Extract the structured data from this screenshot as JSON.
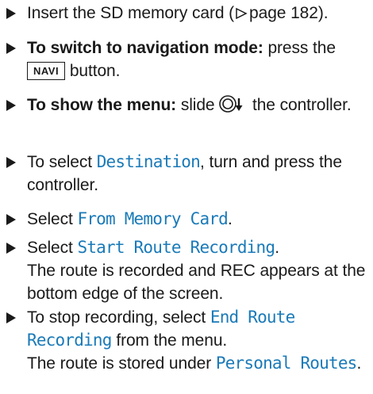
{
  "steps": [
    {
      "text_before": "Insert the SD memory card (",
      "ref": "page 182",
      "text_after": ")."
    },
    {
      "bold": "To switch to navigation mode:",
      "text_before": " press the ",
      "key": "NAVI",
      "text_after": " button."
    },
    {
      "bold": "To show the menu:",
      "text_before": " slide ",
      "text_after": " the control­ler."
    },
    {
      "text_before": "To select ",
      "ui": "Destination",
      "text_after": ", turn and press the controller."
    },
    {
      "text_before": "Select ",
      "ui": "From Memory Card",
      "text_after": "."
    },
    {
      "text_before": "Select ",
      "ui": "Start Route Recording",
      "text_after": ".",
      "result": "The route is recorded and REC appears at the bottom edge of the screen."
    },
    {
      "text_before": "To stop recording, select ",
      "ui": "End Route Recording",
      "text_after": " from the menu.",
      "result_before": "The route is stored under ",
      "result_ui": "Personal Routes",
      "result_after": "."
    }
  ],
  "icons": {
    "bullet": "triangle-right-bullet-icon",
    "page_ref": "page-reference-triangle-icon",
    "controller": "controller-slide-down-icon"
  },
  "colors": {
    "text": "#1a1a1a",
    "ui_text": "#1a7ab8"
  }
}
